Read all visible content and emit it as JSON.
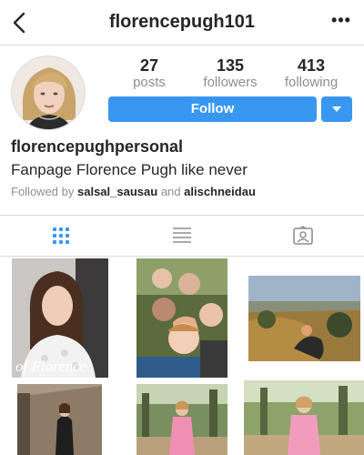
{
  "header": {
    "username": "florencepugh101",
    "back_icon": "chevron-left-icon",
    "more_label": "•••"
  },
  "profile": {
    "stats": [
      {
        "value": "27",
        "label": "posts"
      },
      {
        "value": "135",
        "label": "followers"
      },
      {
        "value": "413",
        "label": "following"
      }
    ],
    "follow_label": "Follow",
    "display_name": "florencepughpersonal",
    "bio": "Fanpage Florence Pugh like never",
    "followed_by": {
      "prefix": "Followed by",
      "user1": "salsal_sausau",
      "conjunction": "and",
      "user2": "alischneidau"
    }
  },
  "tabs": {
    "active_color": "#3897f0",
    "inactive_color": "#8e8e8e",
    "items": [
      {
        "name": "grid-view",
        "icon": "grid-icon"
      },
      {
        "name": "list-view",
        "icon": "list-icon"
      },
      {
        "name": "tagged",
        "icon": "tagged-icon"
      }
    ]
  },
  "posts": {
    "magazine_caption": "of Florence",
    "photos": [
      "magazine-cover",
      "group-selfie",
      "hillside-sunset",
      "brick-corridor-pose",
      "pink-dress-garden",
      "pink-dress-garden-2"
    ]
  },
  "colors": {
    "accent": "#3897f0",
    "text": "#262626",
    "muted": "#8e8e8e",
    "divider": "#dbdbdb"
  }
}
